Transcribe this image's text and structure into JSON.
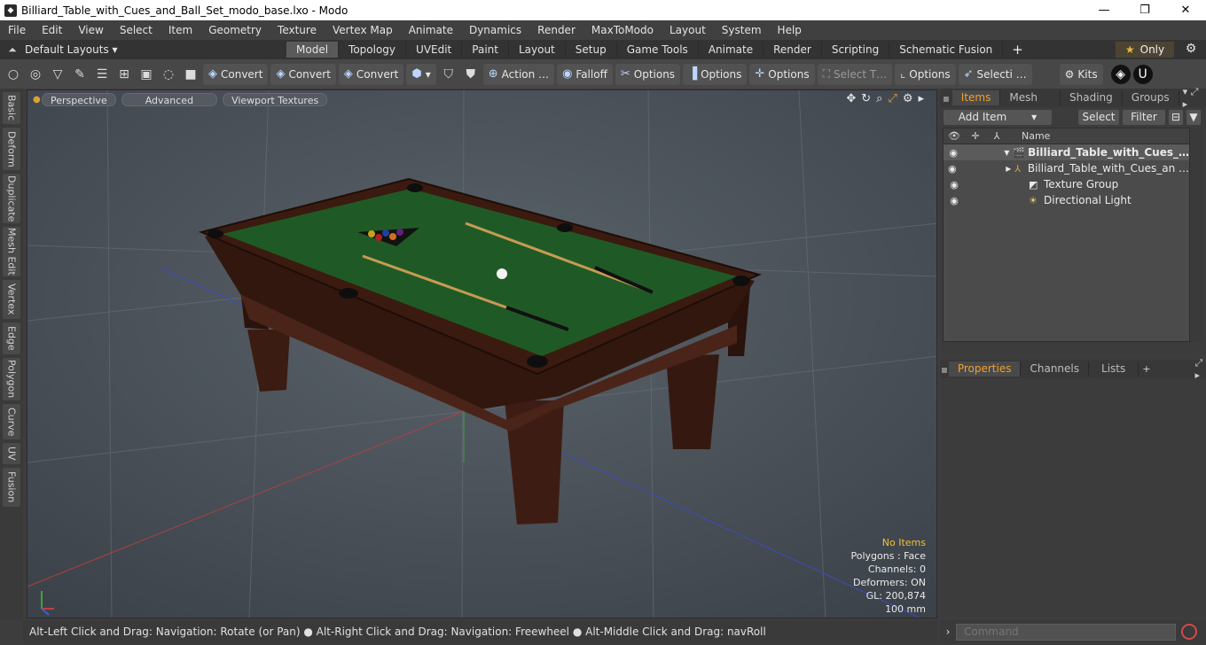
{
  "window": {
    "title": "Billiard_Table_with_Cues_and_Ball_Set_modo_base.lxo - Modo",
    "minimize": "—",
    "maximize": "❐",
    "close": "✕"
  },
  "menu": [
    "File",
    "Edit",
    "View",
    "Select",
    "Item",
    "Geometry",
    "Texture",
    "Vertex Map",
    "Animate",
    "Dynamics",
    "Render",
    "MaxToModo",
    "Layout",
    "System",
    "Help"
  ],
  "layouts": {
    "label": "Default Layouts ▾"
  },
  "tabs": [
    "Model",
    "Topology",
    "UVEdit",
    "Paint",
    "Layout",
    "Setup",
    "Game Tools",
    "Animate",
    "Render",
    "Scripting",
    "Schematic Fusion"
  ],
  "active_tab": "Model",
  "only_label": "Only",
  "toolbar": {
    "convert1": "Convert",
    "convert2": "Convert",
    "convert3": "Convert",
    "action": "Action …",
    "falloff": "Falloff",
    "options1": "Options",
    "options2": "Options",
    "options3": "Options",
    "select_t": "Select T…",
    "options4": "Options",
    "selecti": "Selecti …",
    "kits": "Kits"
  },
  "left_tabs": [
    "Basic",
    "Deform",
    "Duplicate",
    "Mesh Edit",
    "Vertex",
    "Edge",
    "Polygon",
    "Curve",
    "UV",
    "Fusion"
  ],
  "viewport": {
    "perspective": "Perspective",
    "advanced": "Advanced",
    "textures": "Viewport Textures",
    "info": {
      "no_items": "No Items",
      "polygons": "Polygons : Face",
      "channels": "Channels: 0",
      "deformers": "Deformers: ON",
      "gl": "GL: 200,874",
      "scale": "100 mm"
    }
  },
  "status": "Alt-Left Click and Drag: Navigation: Rotate (or Pan) ● Alt-Right Click and Drag: Navigation: Freewheel ● Alt-Middle Click and Drag: navRoll",
  "items_panel": {
    "tabs": [
      "Items",
      "Mesh …",
      "Shading",
      "Groups"
    ],
    "add_item": "Add Item",
    "select": "Select",
    "filter": "Filter",
    "col_name": "Name",
    "rows": [
      {
        "label": "Billiard_Table_with_Cues_…",
        "icon": "scene-icon"
      },
      {
        "label": "Billiard_Table_with_Cues_an …",
        "icon": "mesh-icon"
      },
      {
        "label": "Texture Group",
        "icon": "texture-group-icon"
      },
      {
        "label": "Directional Light",
        "icon": "light-icon"
      }
    ]
  },
  "properties_panel": {
    "tabs": [
      "Properties",
      "Channels",
      "Lists"
    ]
  },
  "command": {
    "placeholder": "Command"
  },
  "colors": {
    "felt": "#1f5a26",
    "wood": "#3a1c12",
    "accent": "#f0a030"
  }
}
